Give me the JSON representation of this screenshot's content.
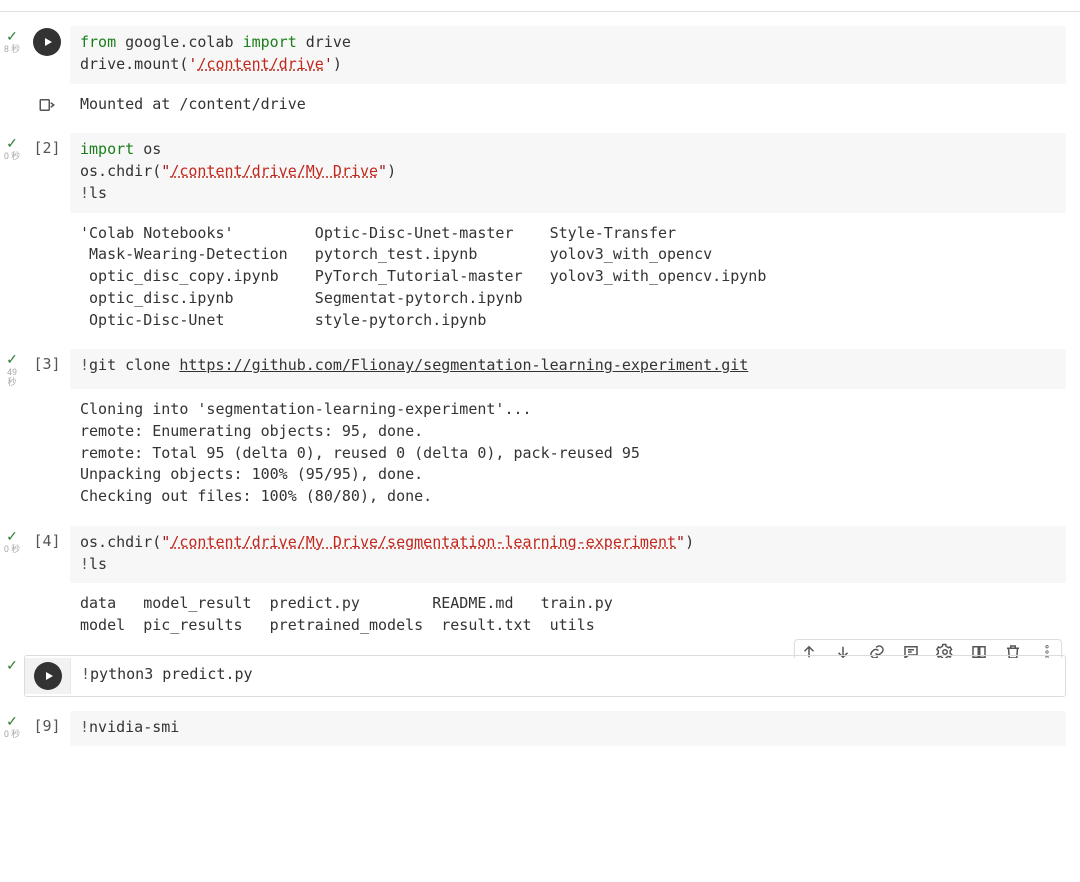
{
  "cells": [
    {
      "status": {
        "check": "✓",
        "time": "8 秒"
      },
      "exec": {
        "play": true
      },
      "code_html": "<span class='kw'>from</span> google.colab <span class='kw'>import</span> drive\ndrive.mount(<span class='str'>'</span><span class='str-link'>/content/drive</span><span class='str'>'</span>)",
      "output_icon": true,
      "output": "Mounted at /content/drive"
    },
    {
      "status": {
        "check": "✓",
        "time": "0 秒"
      },
      "exec": {
        "count": "[2]"
      },
      "code_html": "<span class='kw'>import</span> os\nos.chdir(<span class='str'>\"</span><span class='str-link'>/content/drive/My Drive</span><span class='str'>\"</span>)\n<span class='bang'>!</span>ls",
      "output": "'Colab Notebooks'\t  Optic-Disc-Unet-master    Style-Transfer\n Mask-Wearing-Detection   pytorch_test.ipynb\t    yolov3_with_opencv\n optic_disc_copy.ipynb\t  PyTorch_Tutorial-master   yolov3_with_opencv.ipynb\n optic_disc.ipynb\t  Segmentat-pytorch.ipynb\n Optic-Disc-Unet\t  style-pytorch.ipynb"
    },
    {
      "status": {
        "check": "✓",
        "time": "49\n秒"
      },
      "exec": {
        "count": "[3]"
      },
      "code_html": "<span class='bang'>!</span>git clone <span class='url-link'>https://github.com/Flionay/segmentation-learning-experiment.git</span>",
      "output": "Cloning into 'segmentation-learning-experiment'...\nremote: Enumerating objects: 95, done.\nremote: Total 95 (delta 0), reused 0 (delta 0), pack-reused 95\nUnpacking objects: 100% (95/95), done.\nChecking out files: 100% (80/80), done."
    },
    {
      "status": {
        "check": "✓",
        "time": "0 秒"
      },
      "exec": {
        "count": "[4]"
      },
      "code_html": "os.chdir(<span class='str'>\"</span><span class='str-link'>/content/drive/My Drive/segmentation-learning-experiment</span><span class='str'>\"</span>)\n<span class='bang'>!</span>ls",
      "output": "data   model_result  predict.py\t       README.md   train.py\nmodel  pic_results   pretrained_models  result.txt  utils"
    },
    {
      "active": true,
      "status": {
        "check": "✓",
        "time": ""
      },
      "exec": {
        "play": true
      },
      "code_html": "<span class='bang'>!</span>python3 predict.py"
    },
    {
      "status": {
        "check": "✓",
        "time": "0 秒"
      },
      "exec": {
        "count": "[9]"
      },
      "code_html": "<span class='bang'>!</span>nvidia-smi"
    }
  ],
  "toolbar": {
    "items": [
      "up",
      "down",
      "link",
      "comment",
      "settings",
      "mirror",
      "delete",
      "more"
    ]
  }
}
